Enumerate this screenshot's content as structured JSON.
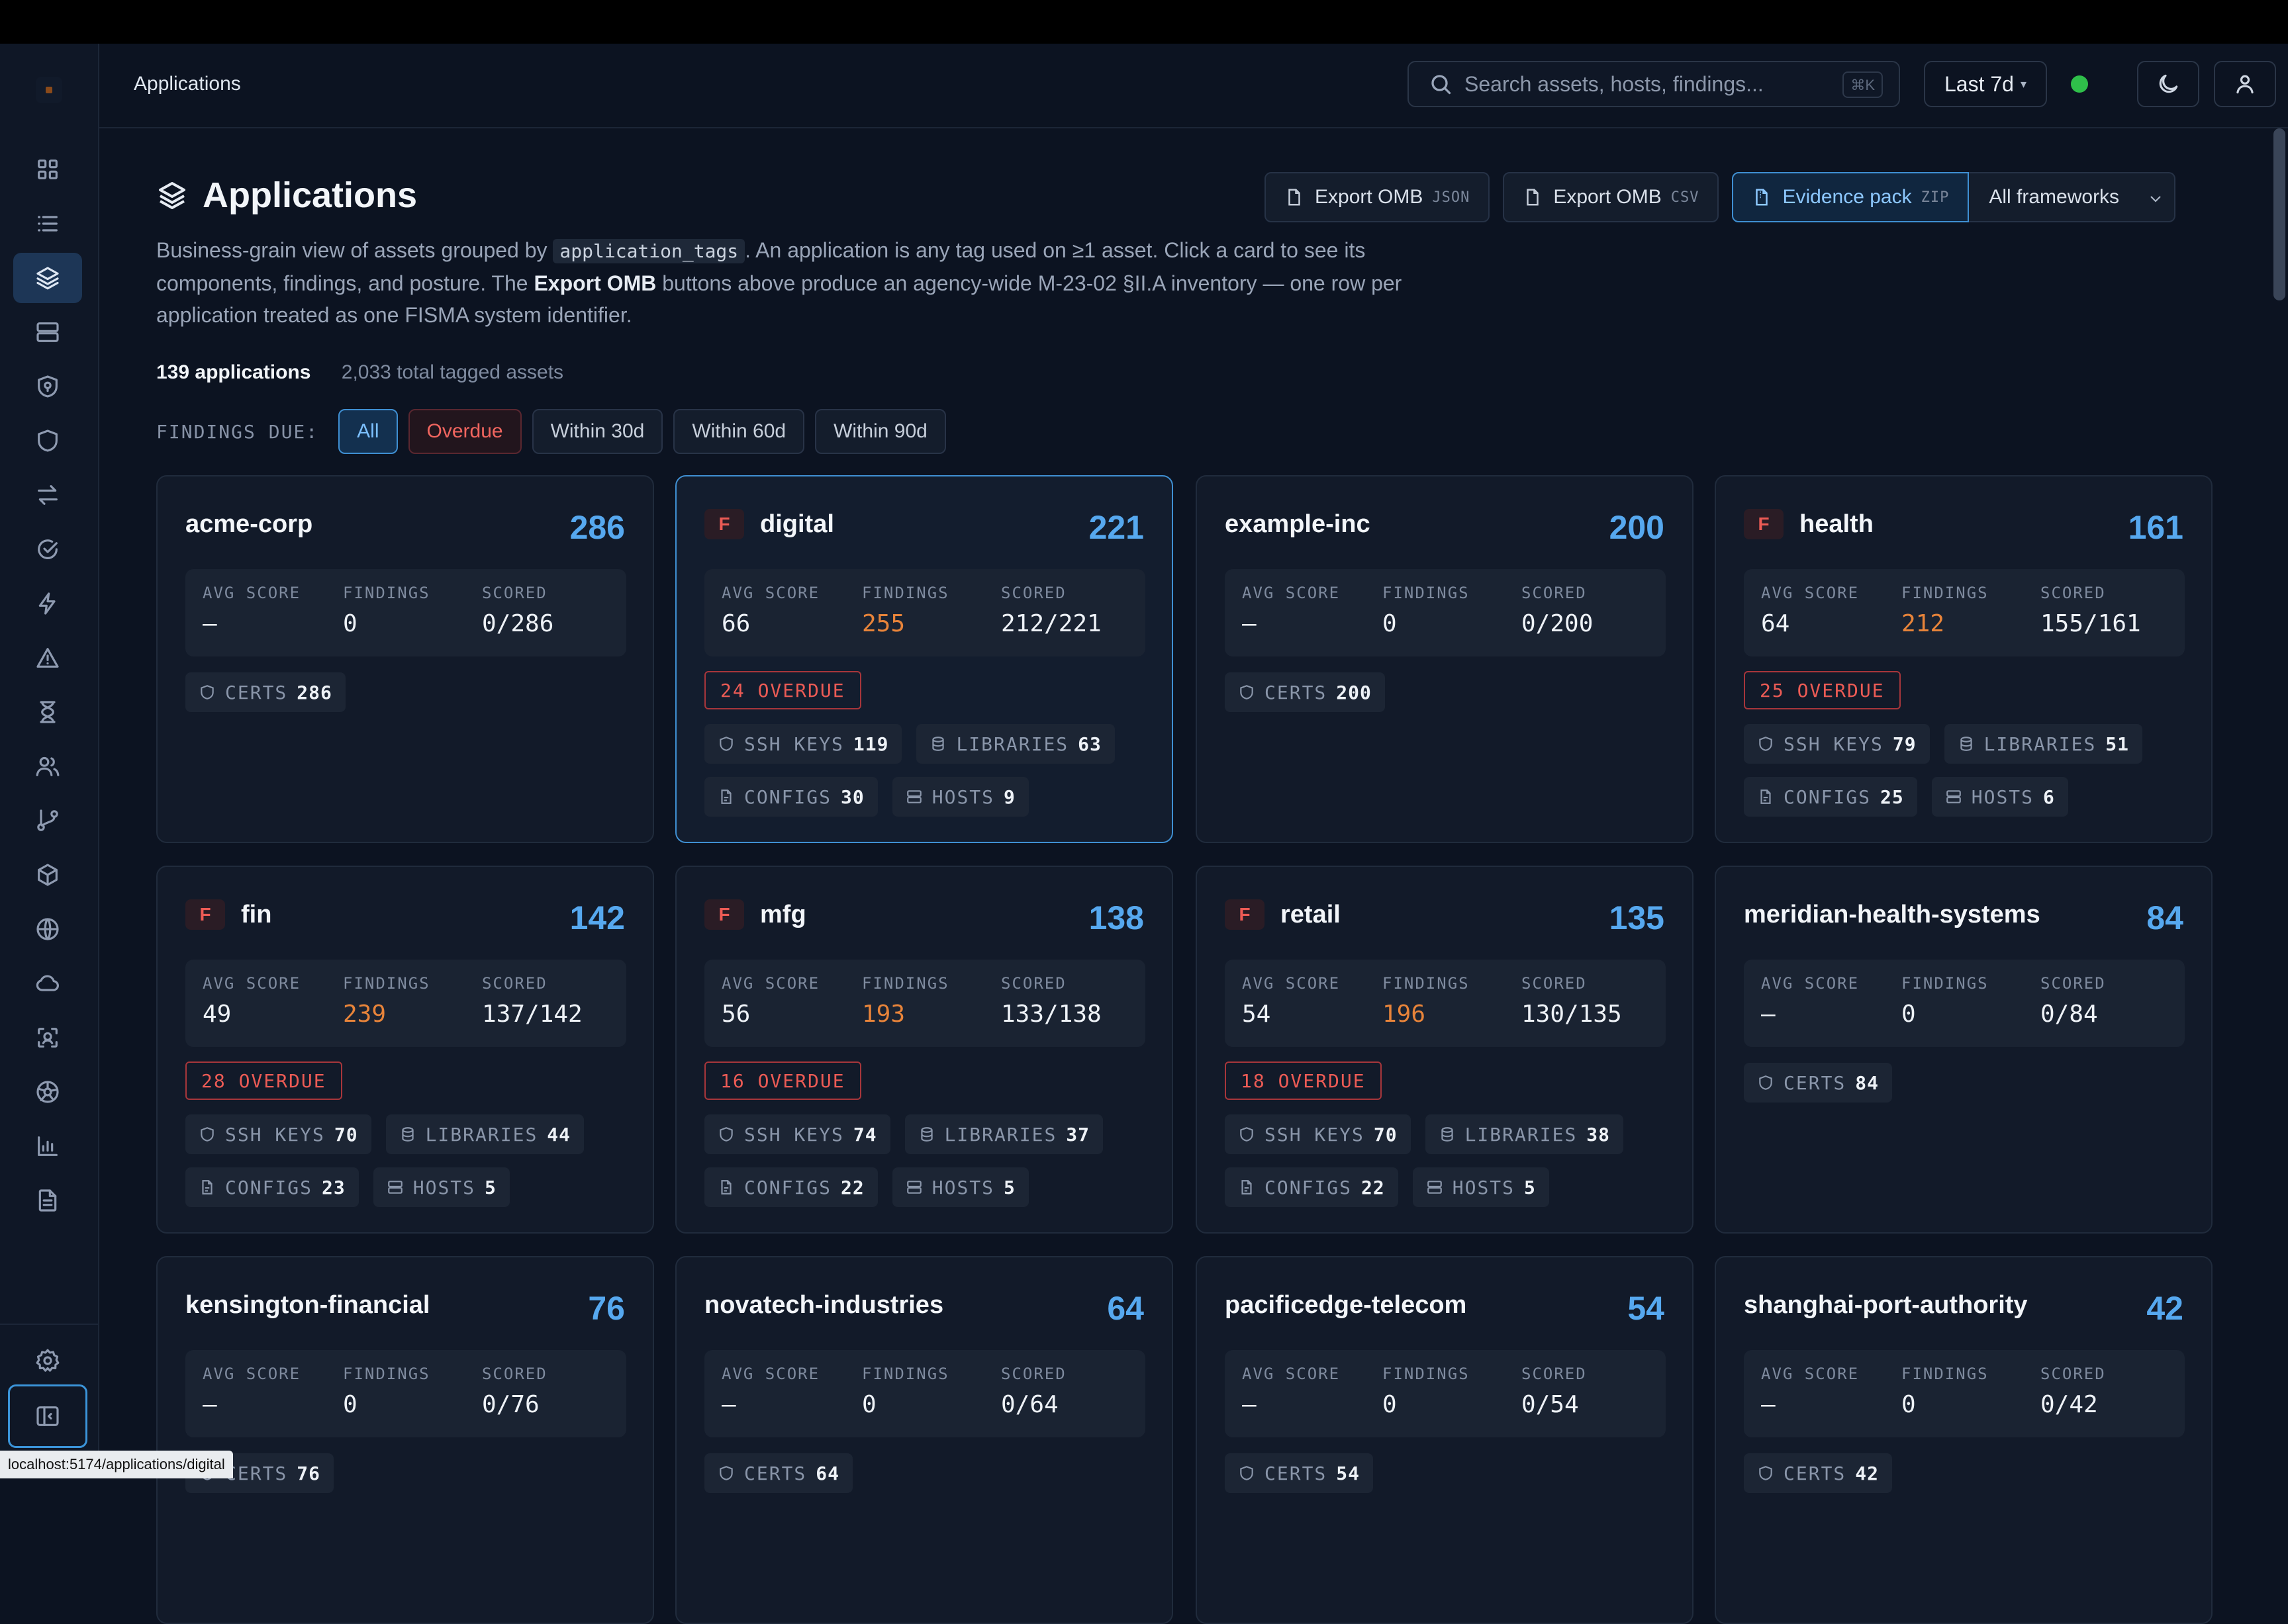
{
  "breadcrumb": "Applications",
  "search": {
    "placeholder": "Search assets, hosts, findings...",
    "shortcut": "⌘K"
  },
  "time_range": "Last 7d",
  "status_color": "#2fbf4a",
  "nav_icons": [
    "grid-icon",
    "list-icon",
    "layers-icon",
    "server-icon",
    "shield-check-icon",
    "shield-icon",
    "arrows-swap-icon",
    "check-circle-icon",
    "bolt-icon",
    "alert-triangle-icon",
    "hourglass-icon",
    "users-icon",
    "git-branch-icon",
    "box-icon",
    "globe-icon",
    "cloud-icon",
    "scan-icon",
    "aperture-icon",
    "bar-chart-icon",
    "file-text-icon",
    "settings-icon",
    "sidebar-toggle-icon"
  ],
  "status_url": "localhost:5174/applications/digital",
  "page": {
    "title": "Applications",
    "desc_1": "Business-grain view of assets grouped by ",
    "desc_code": "application_tags",
    "desc_2": ". An application is any tag used on ≥1 asset. Click a card to see its components, findings, and posture. The ",
    "desc_bold": "Export OMB",
    "desc_3": " buttons above produce an agency-wide M-23-02 §II.A inventory — one row per application treated as one FISMA system identifier.",
    "count_apps": "139 applications",
    "count_assets": "2,033 total tagged assets"
  },
  "actions": {
    "export_json": "Export OMB",
    "export_json_ext": "JSON",
    "export_csv": "Export OMB",
    "export_csv_ext": "CSV",
    "evidence": "Evidence pack",
    "evidence_ext": "ZIP",
    "frameworks": "All frameworks"
  },
  "filters": {
    "label": "FINDINGS DUE:",
    "all": "All",
    "overdue": "Overdue",
    "d30": "Within 30d",
    "d60": "Within 60d",
    "d90": "Within 90d"
  },
  "labels": {
    "avg": "AVG SCORE",
    "findings": "FINDINGS",
    "scored": "SCORED",
    "certs": "CERTS",
    "ssh": "SSH KEYS",
    "libs": "LIBRARIES",
    "configs": "CONFIGS",
    "hosts": "HOSTS"
  },
  "apps": [
    {
      "name": "acme-corp",
      "count": "286",
      "badge": "",
      "avg": "—",
      "findings": "0",
      "scored": "0/286",
      "certs": "286"
    },
    {
      "name": "digital",
      "count": "221",
      "badge": "F",
      "avg": "66",
      "findings": "255",
      "scored": "212/221",
      "overdue": "24 OVERDUE",
      "ssh": "119",
      "libs": "63",
      "configs": "30",
      "hosts": "9"
    },
    {
      "name": "example-inc",
      "count": "200",
      "badge": "",
      "avg": "—",
      "findings": "0",
      "scored": "0/200",
      "certs": "200"
    },
    {
      "name": "health",
      "count": "161",
      "badge": "F",
      "avg": "64",
      "findings": "212",
      "scored": "155/161",
      "overdue": "25 OVERDUE",
      "ssh": "79",
      "libs": "51",
      "configs": "25",
      "hosts": "6"
    },
    {
      "name": "fin",
      "count": "142",
      "badge": "F",
      "avg": "49",
      "findings": "239",
      "scored": "137/142",
      "overdue": "28 OVERDUE",
      "ssh": "70",
      "libs": "44",
      "configs": "23",
      "hosts": "5"
    },
    {
      "name": "mfg",
      "count": "138",
      "badge": "F",
      "avg": "56",
      "findings": "193",
      "scored": "133/138",
      "overdue": "16 OVERDUE",
      "ssh": "74",
      "libs": "37",
      "configs": "22",
      "hosts": "5"
    },
    {
      "name": "retail",
      "count": "135",
      "badge": "F",
      "avg": "54",
      "findings": "196",
      "scored": "130/135",
      "overdue": "18 OVERDUE",
      "ssh": "70",
      "libs": "38",
      "configs": "22",
      "hosts": "5"
    },
    {
      "name": "meridian-health-systems",
      "count": "84",
      "badge": "",
      "avg": "—",
      "findings": "0",
      "scored": "0/84",
      "certs": "84"
    },
    {
      "name": "kensington-financial",
      "count": "76",
      "badge": "",
      "avg": "—",
      "findings": "0",
      "scored": "0/76",
      "certs": "76"
    },
    {
      "name": "novatech-industries",
      "count": "64",
      "badge": "",
      "avg": "—",
      "findings": "0",
      "scored": "0/64",
      "certs": "64"
    },
    {
      "name": "pacificedge-telecom",
      "count": "54",
      "badge": "",
      "avg": "—",
      "findings": "0",
      "scored": "0/54",
      "certs": "54"
    },
    {
      "name": "shanghai-port-authority",
      "count": "42",
      "badge": "",
      "avg": "—",
      "findings": "0",
      "scored": "0/42",
      "certs": "42"
    }
  ]
}
